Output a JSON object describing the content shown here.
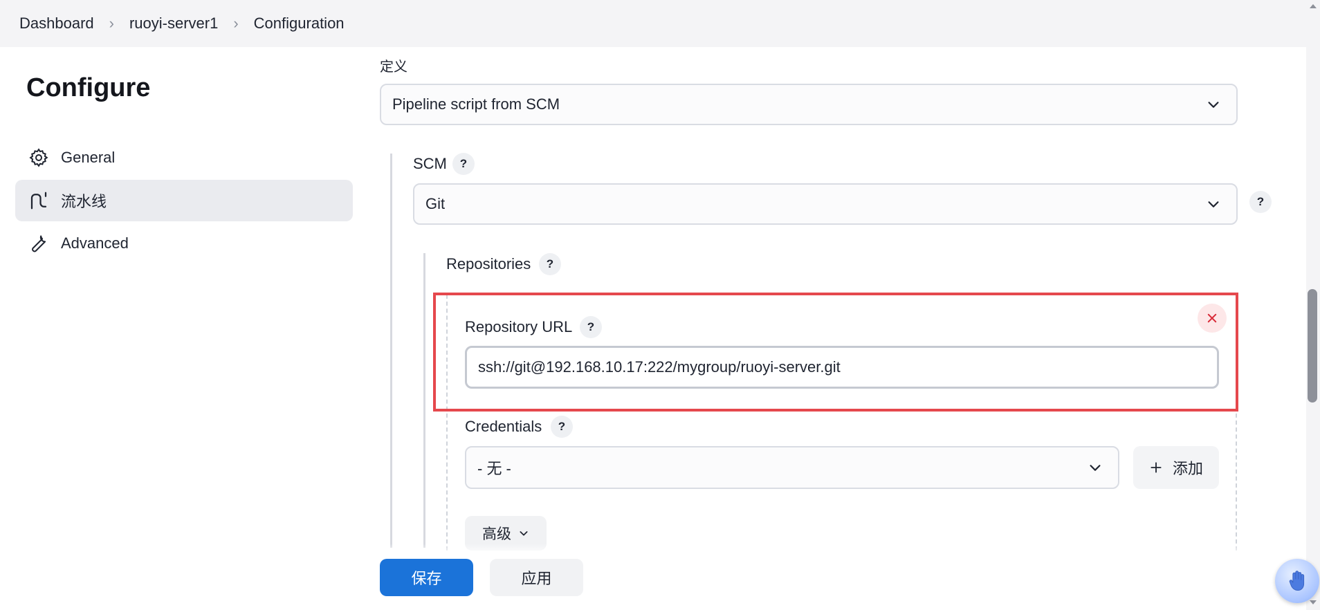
{
  "breadcrumb": {
    "items": [
      "Dashboard",
      "ruoyi-server1",
      "Configuration"
    ]
  },
  "sidebar": {
    "title": "Configure",
    "items": [
      {
        "label": "General",
        "icon": "gear-icon",
        "active": false
      },
      {
        "label": "流水线",
        "icon": "pipeline-icon",
        "active": true
      },
      {
        "label": "Advanced",
        "icon": "wrench-icon",
        "active": false
      }
    ]
  },
  "definition": {
    "label": "定义",
    "value": "Pipeline script from SCM"
  },
  "scm": {
    "label": "SCM",
    "help": "?",
    "value": "Git",
    "help2": "?"
  },
  "repositories": {
    "label": "Repositories",
    "help": "?",
    "repository_url": {
      "label": "Repository URL",
      "help": "?",
      "value": "ssh://git@192.168.10.17:222/mygroup/ruoyi-server.git"
    },
    "credentials": {
      "label": "Credentials",
      "help": "?",
      "value": "- 无 -",
      "add_label": "添加"
    },
    "advanced_label": "高级"
  },
  "actions": {
    "save_label": "保存",
    "apply_label": "应用"
  },
  "colors": {
    "primary": "#1b73d9",
    "highlight": "#e5484d",
    "active_bg": "#eaebef"
  }
}
